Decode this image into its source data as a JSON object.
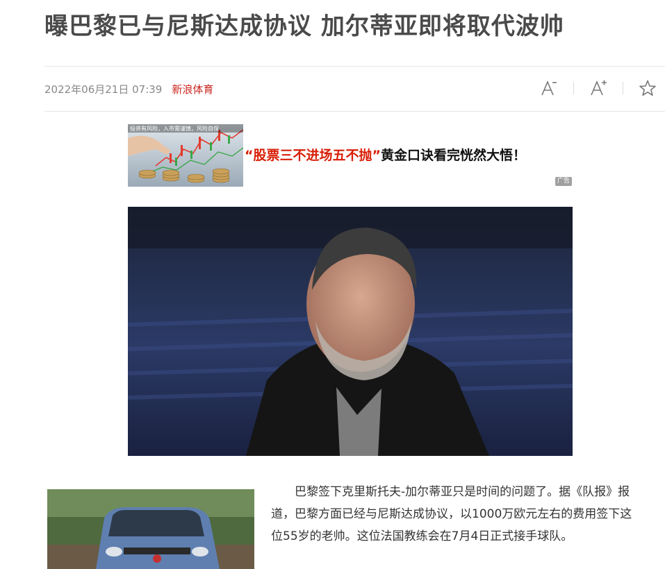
{
  "article": {
    "title": "曝巴黎已与尼斯达成协议 加尔蒂亚即将取代波帅",
    "date": "2022年06月21日 07:39",
    "source": "新浪体育",
    "paragraph": "巴黎签下克里斯托夫-加尔蒂亚只是时间的问题了。据《队报》报道，巴黎方面已经与尼斯达成协议，以1000万欧元左右的费用签下这位55岁的老帅。这位法国教练会在7月4日正式接手球队。"
  },
  "toolbar": {
    "font_decrease_icon": "font-decrease-icon",
    "font_increase_icon": "font-increase-icon",
    "favorite_icon": "star-icon"
  },
  "ad": {
    "thumb_caption": "投资有风险，入市需谨慎，风险自保",
    "headline_quote": "“股票三不进场五不抛”",
    "headline_rest": "黄金口诀看完恍然大悟！",
    "badge": "广告"
  },
  "colors": {
    "accent": "#c8261f",
    "ad_highlight": "#d81e06",
    "title": "#4a4a4a"
  }
}
